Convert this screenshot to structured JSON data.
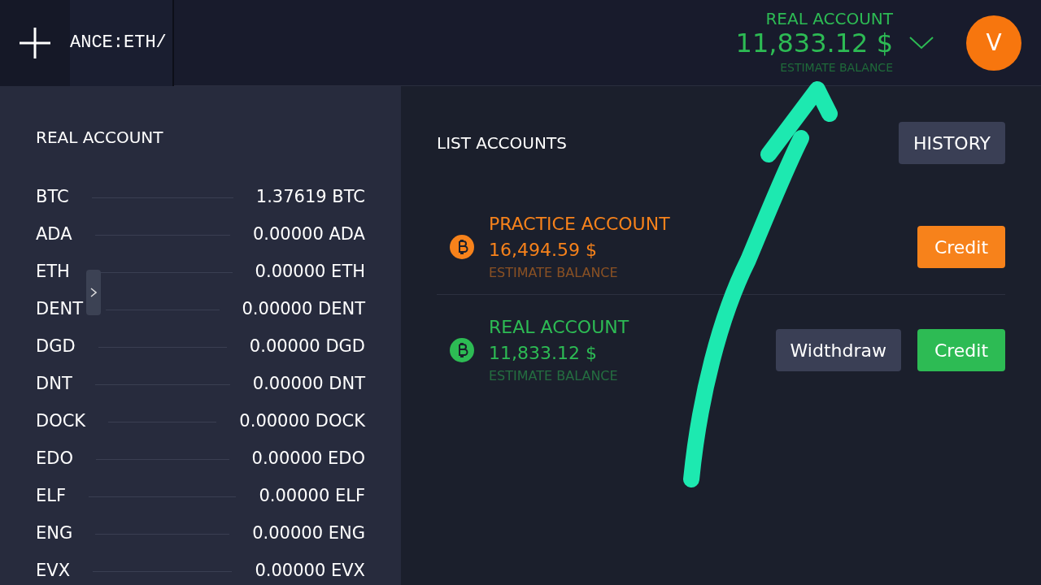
{
  "top_bar": {
    "symbol": "ANCE:ETH/",
    "account": {
      "title": "REAL ACCOUNT",
      "balance": "11,833.12 $",
      "caption": "ESTIMATE BALANCE"
    },
    "avatar": "V"
  },
  "wallet": {
    "title": "REAL ACCOUNT",
    "rows": [
      {
        "coin": "BTC",
        "amount": "1.37619 BTC"
      },
      {
        "coin": "ADA",
        "amount": "0.00000 ADA"
      },
      {
        "coin": "ETH",
        "amount": "0.00000 ETH"
      },
      {
        "coin": "DENT",
        "amount": "0.00000 DENT"
      },
      {
        "coin": "DGD",
        "amount": "0.00000 DGD"
      },
      {
        "coin": "DNT",
        "amount": "0.00000 DNT"
      },
      {
        "coin": "DOCK",
        "amount": "0.00000 DOCK"
      },
      {
        "coin": "EDO",
        "amount": "0.00000 EDO"
      },
      {
        "coin": "ELF",
        "amount": "0.00000 ELF"
      },
      {
        "coin": "ENG",
        "amount": "0.00000 ENG"
      },
      {
        "coin": "EVX",
        "amount": "0.00000 EVX"
      }
    ]
  },
  "accounts_panel": {
    "title": "LIST ACCOUNTS",
    "history_button": "HISTORY",
    "accounts": [
      {
        "name": "PRACTICE ACCOUNT",
        "balance": "16,494.59 $",
        "caption": "ESTIMATE BALANCE",
        "color": "#f7821b",
        "buttons": [
          {
            "kind": "credit",
            "label": "Credit"
          }
        ]
      },
      {
        "name": "REAL ACCOUNT",
        "balance": "11,833.12 $",
        "caption": "ESTIMATE BALANCE",
        "color": "#2dbb54",
        "buttons": [
          {
            "kind": "withdraw",
            "label": "Widthdraw"
          },
          {
            "kind": "credit",
            "label": "Credit"
          }
        ]
      }
    ]
  }
}
